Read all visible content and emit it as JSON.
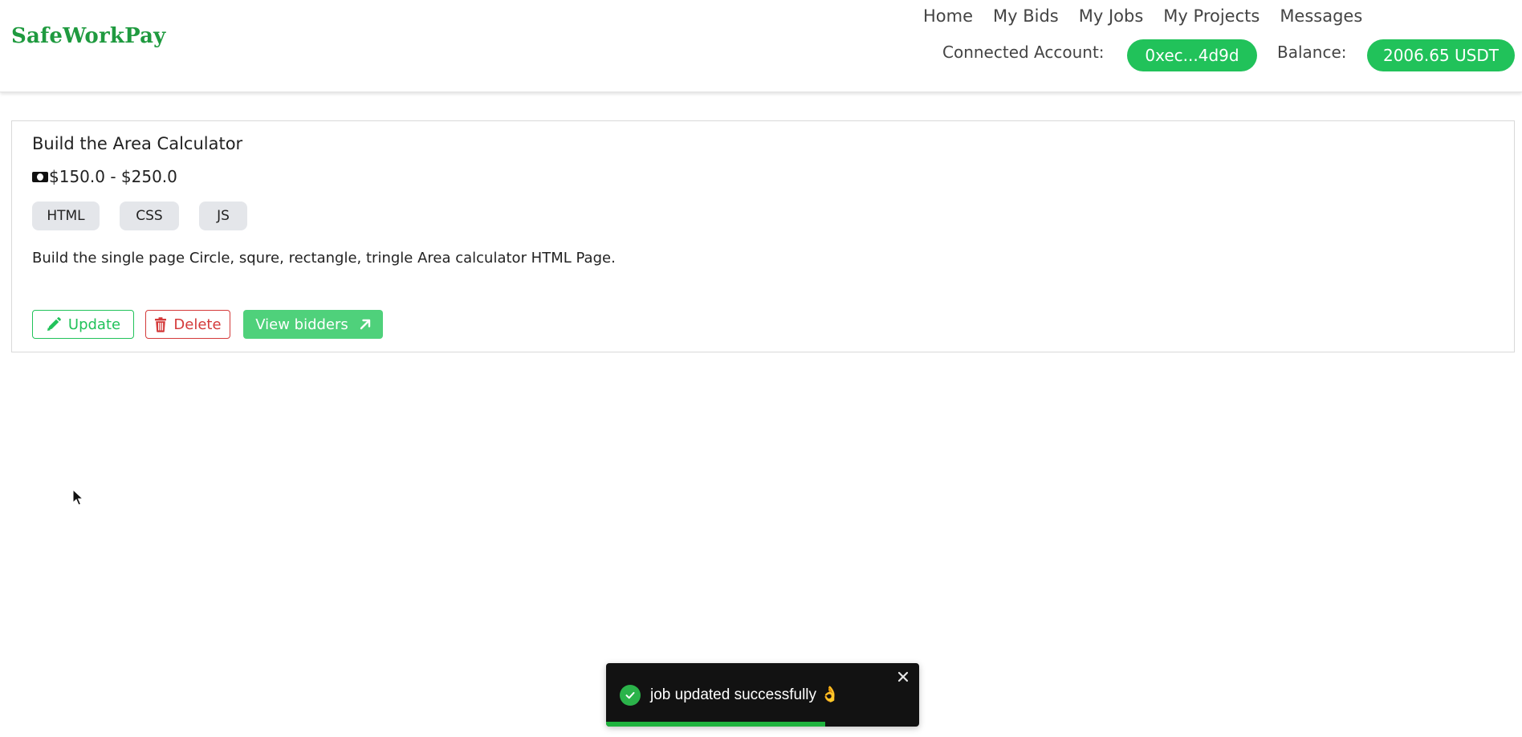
{
  "header": {
    "logo": "SafeWorkPay",
    "nav": [
      {
        "label": "Home"
      },
      {
        "label": "My Bids"
      },
      {
        "label": "My Jobs"
      },
      {
        "label": "My Projects"
      },
      {
        "label": "Messages"
      }
    ],
    "connected_label": "Connected Account:",
    "account": "0xec...4d9d",
    "balance_label": "Balance:",
    "balance": "2006.65 USDT"
  },
  "job": {
    "title": "Build the Area Calculator",
    "budget": "$150.0 - $250.0",
    "tags": [
      "HTML",
      "CSS",
      "JS"
    ],
    "description": "Build the single page Circle, squre, rectangle, tringle Area calculator HTML Page.",
    "actions": {
      "update": "Update",
      "delete": "Delete",
      "view": "View bidders"
    }
  },
  "toast": {
    "message": "job updated successfully 👌",
    "progress": 0.7
  },
  "colors": {
    "brand": "#1f9a3f",
    "accent": "#21c25a",
    "danger": "#d43a3a",
    "toast_bg": "#121212"
  },
  "icons": {
    "budget": "money-icon",
    "update": "pencil-icon",
    "delete": "trash-icon",
    "view": "arrow-up-right-icon",
    "toast_status": "check-circle-icon",
    "toast_close": "close-icon",
    "pointer": "cursor-icon"
  }
}
